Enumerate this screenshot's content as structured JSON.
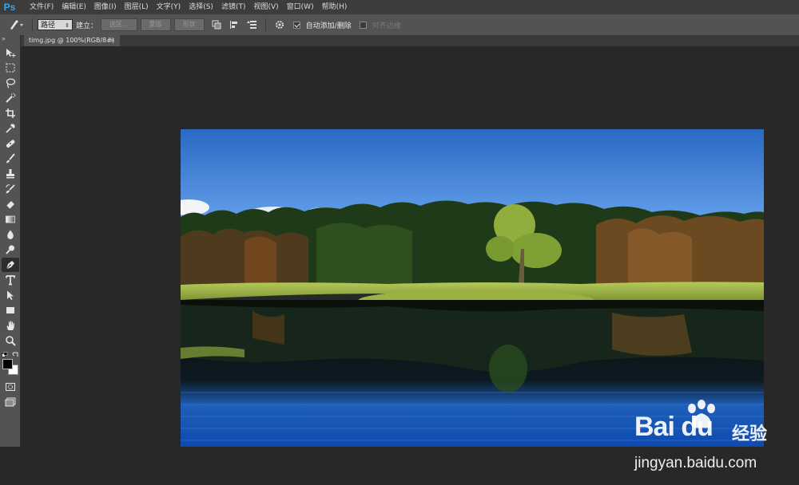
{
  "app": {
    "logo": "Ps"
  },
  "menu": [
    "文件(F)",
    "编辑(E)",
    "图像(I)",
    "图层(L)",
    "文字(Y)",
    "选择(S)",
    "滤镜(T)",
    "视图(V)",
    "窗口(W)",
    "帮助(H)"
  ],
  "options": {
    "mode_select": "路径",
    "make_label": "建立：",
    "selection_button": "选区...",
    "mask_button": "蒙版",
    "shape_button": "形状",
    "auto_add_delete": {
      "label": "自动添加/删除",
      "checked": true
    },
    "align_edges": {
      "label": "对齐边缘",
      "checked": false
    }
  },
  "document": {
    "tab_title": "timg.jpg @ 100%(RGB/8#)",
    "close": "×"
  },
  "toolbox": {
    "collapse": "»",
    "tools": [
      "move-tool",
      "marquee-tool",
      "lasso-tool",
      "quick-select-tool",
      "crop-tool",
      "eyedropper-tool",
      "healing-brush-tool",
      "brush-tool",
      "clone-stamp-tool",
      "history-brush-tool",
      "eraser-tool",
      "gradient-tool",
      "blur-tool",
      "dodge-tool",
      "pen-tool",
      "type-tool",
      "path-selection-tool",
      "rectangle-tool",
      "hand-tool",
      "zoom-tool"
    ],
    "active": "pen-tool",
    "foreground": "#000000",
    "background": "#ffffff"
  },
  "watermark": {
    "logo": "Bai du",
    "cn": "经验",
    "url": "jingyan.baidu.com"
  },
  "colors": {
    "menubar": "#3c3c3c",
    "options": "#535353",
    "canvas": "#282828",
    "accent": "#31a8ff"
  }
}
